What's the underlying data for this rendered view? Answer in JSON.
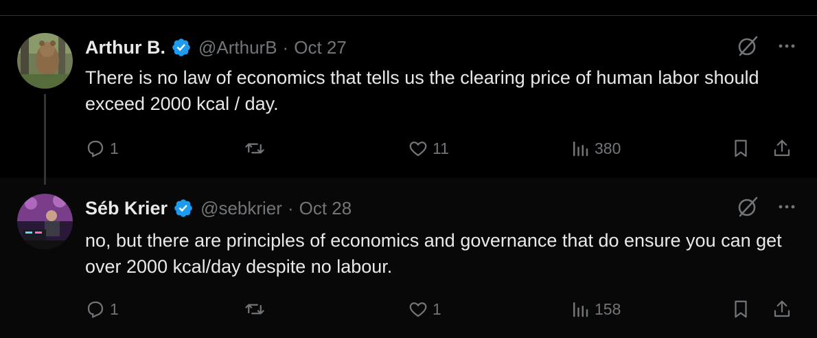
{
  "thread": [
    {
      "author_name": "Arthur B.",
      "handle": "@ArthurB",
      "separator": "·",
      "date": "Oct 27",
      "text": "There is no law of economics that tells us the clearing price of human labor should exceed 2000 kcal / day.",
      "reply_count": "1",
      "retweet_count": "",
      "like_count": "11",
      "view_count": "380"
    },
    {
      "author_name": "Séb Krier",
      "handle": "@sebkrier",
      "separator": "·",
      "date": "Oct 28",
      "text": "no, but there are principles of economics and governance that do ensure you can get over 2000 kcal/day despite no labour.",
      "reply_count": "1",
      "retweet_count": "",
      "like_count": "1",
      "view_count": "158"
    }
  ],
  "colors": {
    "background": "#000000",
    "reply_background": "#080808",
    "text_primary": "#e7e9ea",
    "text_secondary": "#71767b",
    "verified_blue": "#1d9bf0",
    "divider": "#2f3336"
  },
  "icons": [
    "verified-badge-icon",
    "grok-icon",
    "more-icon",
    "reply-icon",
    "retweet-icon",
    "like-icon",
    "views-icon",
    "bookmark-icon",
    "share-icon"
  ]
}
